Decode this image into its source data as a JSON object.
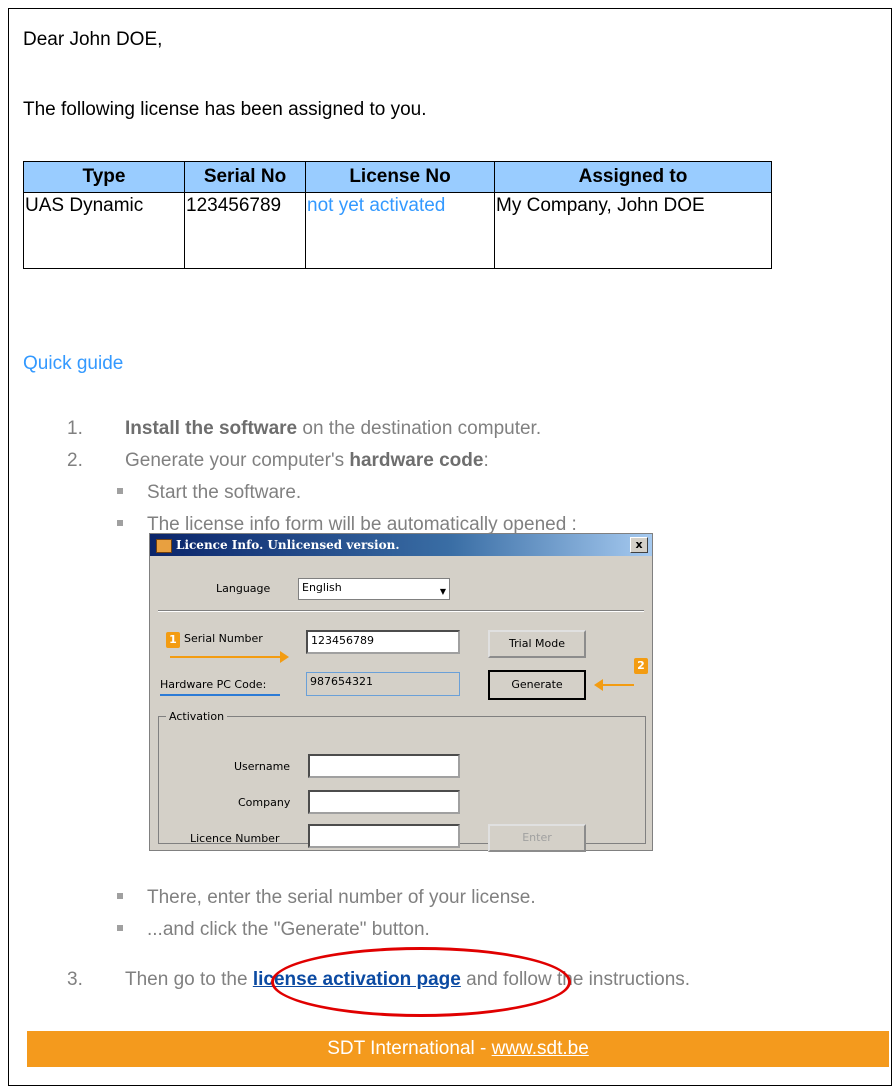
{
  "greeting": "Dear John DOE,",
  "intro": "The following license has been assigned to you.",
  "license_table": {
    "headers": [
      "Type",
      "Serial No",
      "License No",
      "Assigned to"
    ],
    "rows": [
      [
        "UAS Dynamic",
        "123456789",
        "not yet activated",
        "My Company, John DOE"
      ]
    ]
  },
  "quick_guide": {
    "title": "Quick guide",
    "step1": {
      "num": "1.",
      "bold": "Install the software",
      "rest": " on the destination computer."
    },
    "step2": {
      "num": "2.",
      "text": "Generate your computer's ",
      "bold": "hardware code",
      "rest": ":"
    },
    "bullets_a": [
      "Start the software.",
      "The license info form will be automatically opened :"
    ],
    "bullets_b": [
      "There, enter the serial number of your license.",
      "...and click the \"Generate\" button."
    ],
    "step3": {
      "num": "3.",
      "pre": "Then go to the ",
      "link": "license activation page",
      "post": " and follow the instructions."
    }
  },
  "dialog": {
    "title": "Licence Info. Unlicensed version.",
    "close": "x",
    "language_label": "Language",
    "language_value": "English",
    "serial_label": "Serial Number",
    "serial_value": "123456789",
    "hardware_label": "Hardware PC Code:",
    "hardware_value": "987654321",
    "trial_button": "Trial Mode",
    "generate_button": "Generate",
    "activation_group": "Activation",
    "username_label": "Username",
    "company_label": "Company",
    "licence_label": "Licence Number",
    "enter_button": "Enter",
    "badge1": "1",
    "badge2": "2"
  },
  "footer": {
    "text": "SDT International - ",
    "link": "www.sdt.be",
    "color": "#f49a1d"
  },
  "colors": {
    "table_header": "#99ccff",
    "accent_blue": "#3399ff",
    "highlight_ellipse": "#e00000"
  }
}
